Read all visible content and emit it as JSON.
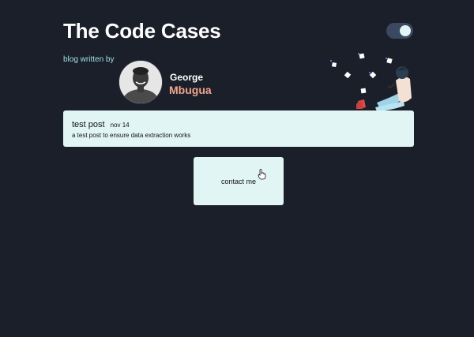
{
  "header": {
    "title": "The Code Cases",
    "theme_toggle": {
      "state": "on",
      "accent": "#e2f5f5"
    }
  },
  "author": {
    "byline": "blog written by",
    "first_name": "George",
    "last_name": "Mbugua",
    "last_name_color": "#f0a58e",
    "avatar_icon": "profile-photo"
  },
  "posts": [
    {
      "title": "test post",
      "date": "nov 14",
      "excerpt": "a test post to ensure data extraction works"
    }
  ],
  "contact": {
    "label": "contact me",
    "cursor_icon": "hand-pointer-icon"
  },
  "colors": {
    "background": "#1b1f2a",
    "card": "#e2f5f5",
    "byline": "#9fe0e3"
  }
}
